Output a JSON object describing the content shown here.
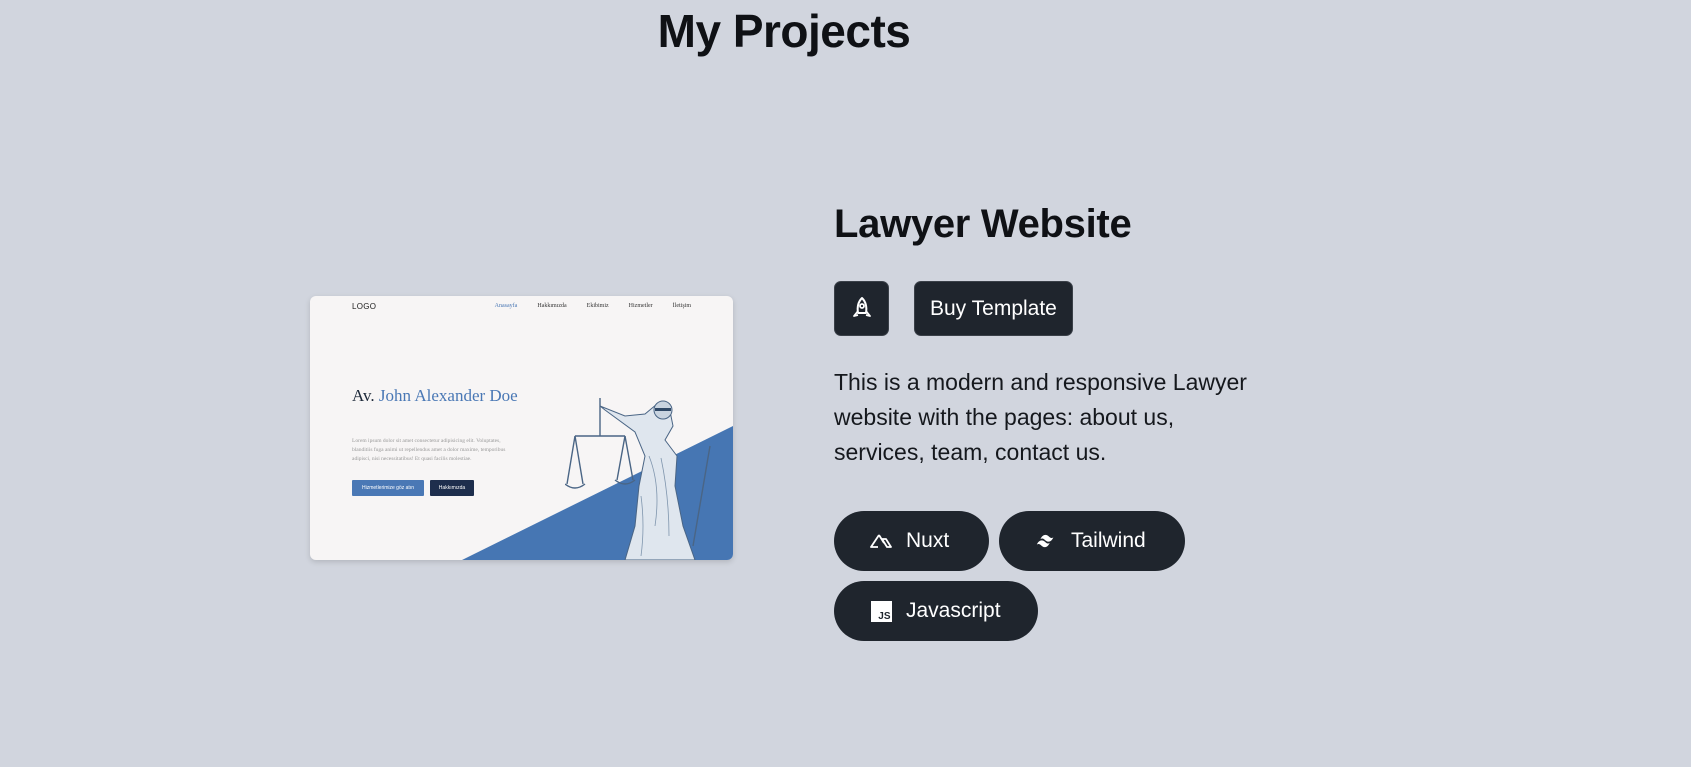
{
  "section": {
    "title": "My Projects"
  },
  "project": {
    "title": "Lawyer Website",
    "buy_label": "Buy Template",
    "launch_icon": "rocket-icon",
    "description": "This is a modern and responsive Lawyer website with the pages: about us, services, team, contact us.",
    "technologies": [
      {
        "label": "Nuxt",
        "icon": "nuxt-icon"
      },
      {
        "label": "Tailwind",
        "icon": "tailwind-icon"
      },
      {
        "label": "Javascript",
        "icon": "javascript-icon",
        "icon_text": "JS"
      }
    ]
  },
  "preview": {
    "logo": "LOGO",
    "nav": [
      "Anasayfa",
      "Hakkımızda",
      "Ekibimiz",
      "Hizmetler",
      "İletişim"
    ],
    "heading_prefix": "Av.",
    "heading_name": "John Alexander Doe",
    "body": "Lorem ipsum dolor sit amet consectetur adipisicing elit. Voluptates, blanditiis fuga animi ut repellendus amet a dolor maxime, temporibus adipisci, nisi necessitatibus! Et quasi facilis molestiae.",
    "button_primary": "Hizmetlerimize göz atın",
    "button_secondary": "Hakkımızda"
  },
  "colors": {
    "background": "#d1d5de",
    "button_bg": "#1f252d",
    "accent_blue": "#4a78b5"
  }
}
